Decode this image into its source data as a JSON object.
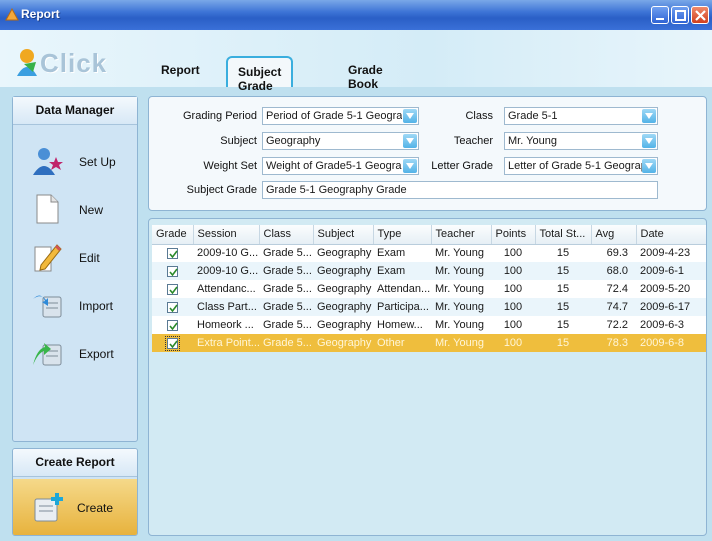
{
  "window": {
    "title": "Report",
    "buttons": [
      "minimize",
      "maximize",
      "close"
    ]
  },
  "logo": {
    "text": "Click"
  },
  "tabs": [
    {
      "label": "Report",
      "active": false
    },
    {
      "label": "Subject Grade",
      "active": true
    },
    {
      "label": "Grade Book",
      "active": false
    }
  ],
  "data_manager": {
    "title": "Data Manager",
    "items": [
      {
        "label": "Set Up",
        "icon": "users-icon"
      },
      {
        "label": "New",
        "icon": "new-document-icon"
      },
      {
        "label": "Edit",
        "icon": "edit-pencil-icon"
      },
      {
        "label": "Import",
        "icon": "import-icon"
      },
      {
        "label": "Export",
        "icon": "export-icon"
      }
    ]
  },
  "create_report": {
    "title": "Create Report",
    "button_label": "Create"
  },
  "form": {
    "grading_period": {
      "label": "Grading Period",
      "value": "Period  of Grade 5-1 Geogra"
    },
    "class": {
      "label": "Class",
      "value": "Grade 5-1"
    },
    "subject": {
      "label": "Subject",
      "value": "Geography"
    },
    "teacher": {
      "label": "Teacher",
      "value": "Mr. Young"
    },
    "weight_set": {
      "label": "Weight Set",
      "value": "Weight of Grade5-1 Geogra"
    },
    "letter_grade": {
      "label": "Letter Grade",
      "value": "Letter of Grade 5-1 Geograp"
    },
    "subject_grade": {
      "label": "Subject Grade",
      "value": "Grade 5-1 Geography Grade"
    }
  },
  "table": {
    "columns": [
      "Grade",
      "Session",
      "Class",
      "Subject",
      "Type",
      "Teacher",
      "Points",
      "Total St...",
      "Avg",
      "Date"
    ],
    "rows": [
      {
        "checked": true,
        "session": "2009-10 G...",
        "class": "Grade 5...",
        "subject": "Geography",
        "type": "Exam",
        "teacher": "Mr. Young",
        "points": "100",
        "total": "15",
        "avg": "69.3",
        "date": "2009-4-23"
      },
      {
        "checked": true,
        "session": "2009-10 G...",
        "class": "Grade 5...",
        "subject": "Geography",
        "type": "Exam",
        "teacher": "Mr. Young",
        "points": "100",
        "total": "15",
        "avg": "68.0",
        "date": "2009-6-1"
      },
      {
        "checked": true,
        "session": "Attendanc...",
        "class": "Grade 5...",
        "subject": "Geography",
        "type": "Attendan...",
        "teacher": "Mr. Young",
        "points": "100",
        "total": "15",
        "avg": "72.4",
        "date": "2009-5-20"
      },
      {
        "checked": true,
        "session": "Class Part...",
        "class": "Grade 5...",
        "subject": "Geography",
        "type": "Participa...",
        "teacher": "Mr. Young",
        "points": "100",
        "total": "15",
        "avg": "74.7",
        "date": "2009-6-17"
      },
      {
        "checked": true,
        "session": "Homeork ...",
        "class": "Grade 5...",
        "subject": "Geography",
        "type": "Homew...",
        "teacher": "Mr. Young",
        "points": "100",
        "total": "15",
        "avg": "72.2",
        "date": "2009-6-3"
      },
      {
        "checked": true,
        "session": "Extra Point...",
        "class": "Grade 5...",
        "subject": "Geography",
        "type": "Other",
        "teacher": "Mr. Young",
        "points": "100",
        "total": "15",
        "avg": "78.3",
        "date": "2009-6-8",
        "selected": true
      }
    ]
  },
  "colors": {
    "accent": "#3aaede",
    "selected_row": "#efbe3d",
    "titlebar": "#2a5fc6"
  }
}
